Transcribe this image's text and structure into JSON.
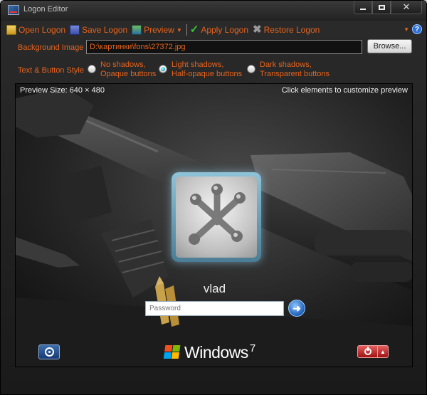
{
  "window": {
    "title": "Logon Editor",
    "controls": {
      "minimize": "minimize",
      "maximize": "maximize",
      "close": "✕"
    }
  },
  "toolbar": {
    "open_label": "Open Logon",
    "save_label": "Save Logon",
    "preview_label": "Preview",
    "apply_label": "Apply Logon",
    "restore_label": "Restore Logon",
    "help_label": "?"
  },
  "background_image": {
    "label": "Background Image",
    "path": "D:\\картинки\\fons\\27372.jpg",
    "browse_label": "Browse..."
  },
  "style": {
    "label": "Text & Button Style",
    "options": [
      {
        "line1": "No shadows,",
        "line2": "Opaque buttons",
        "selected": false
      },
      {
        "line1": "Light shadows,",
        "line2": "Half-opaque buttons",
        "selected": true
      },
      {
        "line1": "Dark shadows,",
        "line2": "Transparent buttons",
        "selected": false
      }
    ]
  },
  "preview": {
    "size_text": "Preview Size: 640 × 480",
    "hint_text": "Click elements to customize preview",
    "username": "vlad",
    "password_placeholder": "Password",
    "go_arrow": "➜",
    "brand_name": "Windows",
    "brand_version": "7",
    "power_arrow": "▲"
  },
  "colors": {
    "accent": "#e8631c",
    "frame": "#1f1f1f",
    "flag_red": "#f25022",
    "flag_green": "#7fba00",
    "flag_blue": "#00a4ef",
    "flag_yellow": "#ffb900"
  },
  "icons": [
    "app-icon",
    "open-icon",
    "save-icon",
    "preview-icon",
    "checkmark-icon",
    "cross-icon",
    "help-icon",
    "ease-of-access-icon",
    "power-icon",
    "windows-flag-icon"
  ]
}
